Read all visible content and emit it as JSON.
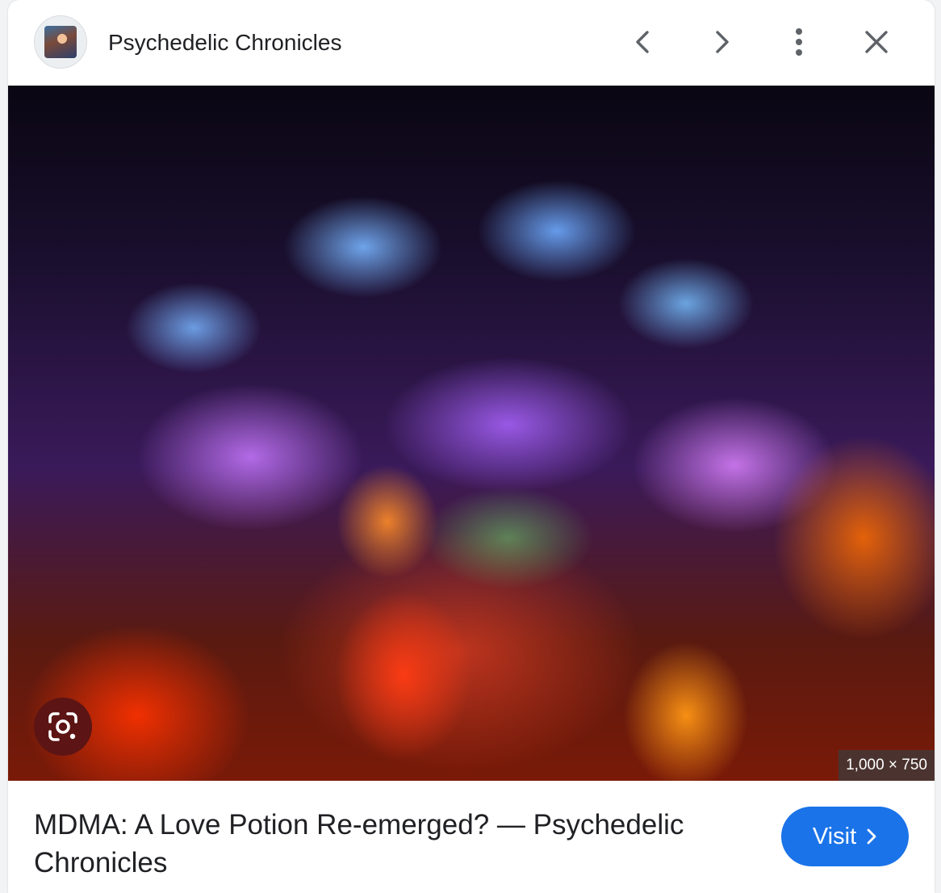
{
  "header": {
    "source_name": "Psychedelic Chronicles",
    "avatar_icon": "site-favicon",
    "prev_icon": "chevron-left-icon",
    "next_icon": "chevron-right-icon",
    "more_icon": "more-vert-icon",
    "close_icon": "close-icon"
  },
  "image": {
    "dimensions": "1,000 × 750",
    "lens_icon": "google-lens-icon"
  },
  "footer": {
    "title": "MDMA: A Love Potion Re-emerged? — Psychedelic Chronicles",
    "visit_label": "Visit",
    "visit_icon": "chevron-right-icon"
  },
  "colors": {
    "accent": "#1a73e8",
    "lens_bg": "#5c1414",
    "text": "#202124",
    "icon": "#5f6368"
  }
}
